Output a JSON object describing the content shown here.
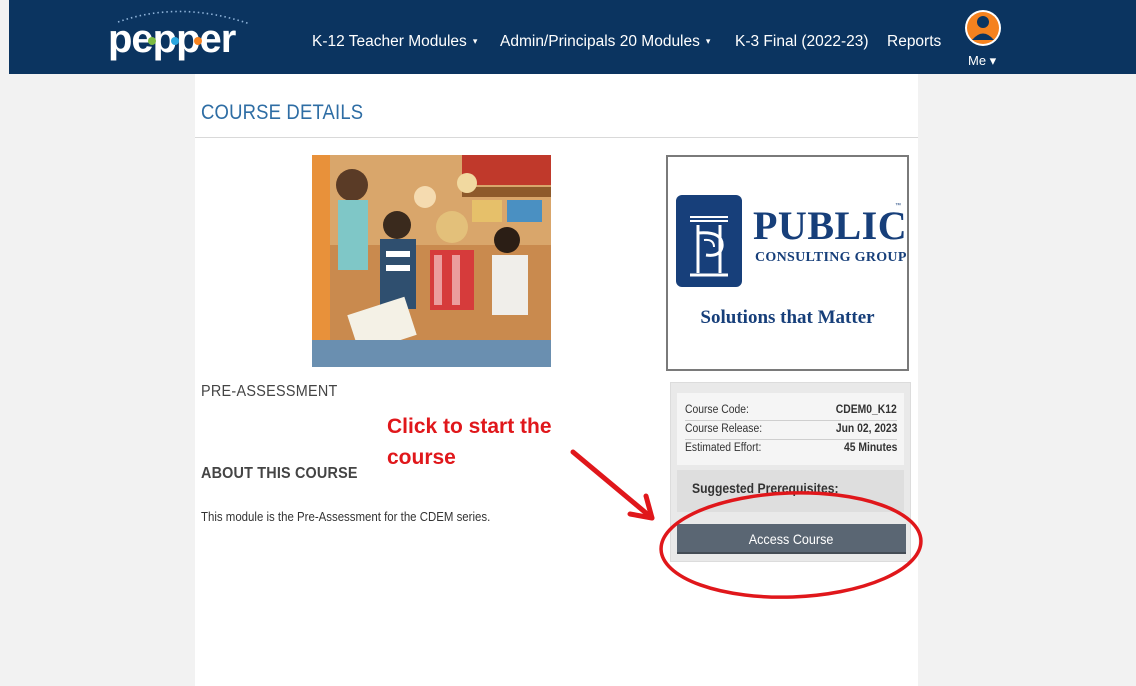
{
  "header": {
    "logo_text": "pepper",
    "nav": [
      {
        "label": "K-12 Teacher Modules",
        "caret": "▾"
      },
      {
        "label": "Admin/Principals 20 Modules",
        "caret": "▾"
      },
      {
        "label": "K-3 Final (2022-23)",
        "caret": ""
      },
      {
        "label": "Reports",
        "caret": ""
      }
    ],
    "user_menu": "Me ▾",
    "colors": {
      "navbar": "#0b3460",
      "avatar": "#f5821f"
    }
  },
  "page": {
    "title": "COURSE DETAILS",
    "course_name": "PRE-ASSESSMENT",
    "about_heading": "ABOUT THIS COURSE",
    "about_text": "This module is the Pre-Assessment for the CDEM series.",
    "course_image": "photo of young children sitting together in a classroom"
  },
  "provider_logo": {
    "name_line1": "PUBLIC",
    "name_line2": "CONSULTING GROUP",
    "trademark": "™",
    "tagline": "Solutions that Matter",
    "color": "#173f7a"
  },
  "course_info": {
    "rows": [
      {
        "label": "Course Code:",
        "value": "CDEM0_K12"
      },
      {
        "label": "Course Release:",
        "value": "Jun 02, 2023"
      },
      {
        "label": "Estimated Effort:",
        "value": "45 Minutes"
      }
    ],
    "prerequisites_label": "Suggested Prerequisites:",
    "access_button": "Access Course"
  },
  "annotation": {
    "text": "Click to start the course",
    "color": "#e0171b"
  }
}
